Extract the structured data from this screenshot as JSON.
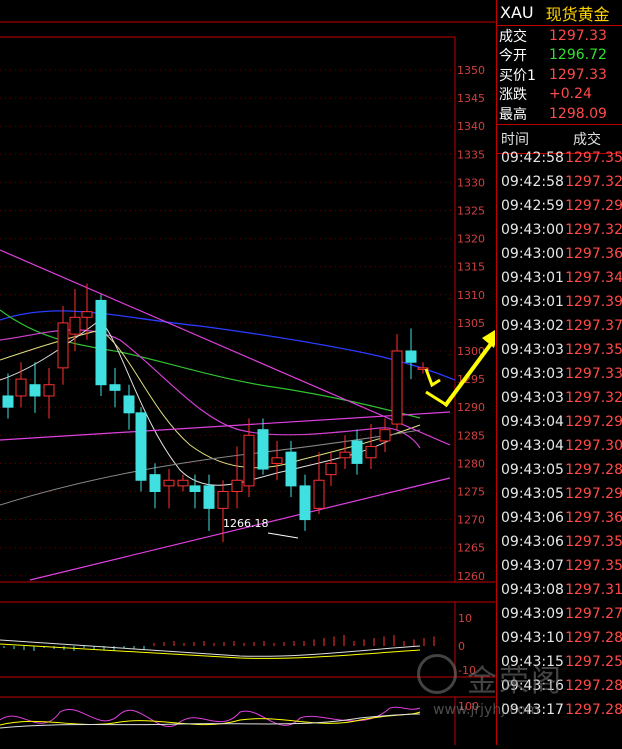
{
  "quote": {
    "symbol": "XAU",
    "name": "现货黄金",
    "rows": [
      {
        "label": "成交",
        "value": "1297.33",
        "color": "red"
      },
      {
        "label": "今开",
        "value": "1296.72",
        "color": "green"
      },
      {
        "label": "买价1",
        "value": "1297.33",
        "color": "red"
      },
      {
        "label": "涨跌",
        "value": "+0.24",
        "color": "red"
      },
      {
        "label": "最高",
        "value": "1298.09",
        "color": "red"
      }
    ],
    "trade_header": {
      "time": "时间",
      "price": "成交"
    },
    "trades": [
      {
        "time": "09:42:58",
        "price": "1297.35"
      },
      {
        "time": "09:42:58",
        "price": "1297.32"
      },
      {
        "time": "09:42:59",
        "price": "1297.29"
      },
      {
        "time": "09:43:00",
        "price": "1297.32"
      },
      {
        "time": "09:43:00",
        "price": "1297.36"
      },
      {
        "time": "09:43:01",
        "price": "1297.34"
      },
      {
        "time": "09:43:01",
        "price": "1297.39"
      },
      {
        "time": "09:43:02",
        "price": "1297.37"
      },
      {
        "time": "09:43:03",
        "price": "1297.35"
      },
      {
        "time": "09:43:03",
        "price": "1297.33"
      },
      {
        "time": "09:43:03",
        "price": "1297.32"
      },
      {
        "time": "09:43:04",
        "price": "1297.29"
      },
      {
        "time": "09:43:04",
        "price": "1297.30"
      },
      {
        "time": "09:43:05",
        "price": "1297.28"
      },
      {
        "time": "09:43:05",
        "price": "1297.29"
      },
      {
        "time": "09:43:06",
        "price": "1297.36"
      },
      {
        "time": "09:43:06",
        "price": "1297.35"
      },
      {
        "time": "09:43:07",
        "price": "1297.35"
      },
      {
        "time": "09:43:08",
        "price": "1297.31"
      },
      {
        "time": "09:43:09",
        "price": "1297.27"
      },
      {
        "time": "09:43:10",
        "price": "1297.28"
      },
      {
        "time": "09:43:15",
        "price": "1297.25"
      },
      {
        "time": "09:43:16",
        "price": "1297.28"
      },
      {
        "time": "09:43:17",
        "price": "1297.28"
      }
    ]
  },
  "chart": {
    "price_ticks": [
      "1350",
      "1345",
      "1340",
      "1335",
      "1330",
      "1325",
      "1320",
      "1315",
      "1310",
      "1305",
      "1300",
      "1295",
      "1290",
      "1285",
      "1280",
      "1275",
      "1270",
      "1265",
      "1260"
    ],
    "low_annotation": "1266.18",
    "macd_ticks": [
      "10",
      "0",
      "-10"
    ],
    "kdj_ticks": [
      "100"
    ],
    "colors": {
      "up": "#ff3030",
      "down": "#40e0e0",
      "grid": "#8b0000",
      "axis": "#d04040",
      "arrow": "#ffff00"
    }
  },
  "watermark": {
    "brand": "金荣阁",
    "url": "www.jrjyhj.com"
  }
}
